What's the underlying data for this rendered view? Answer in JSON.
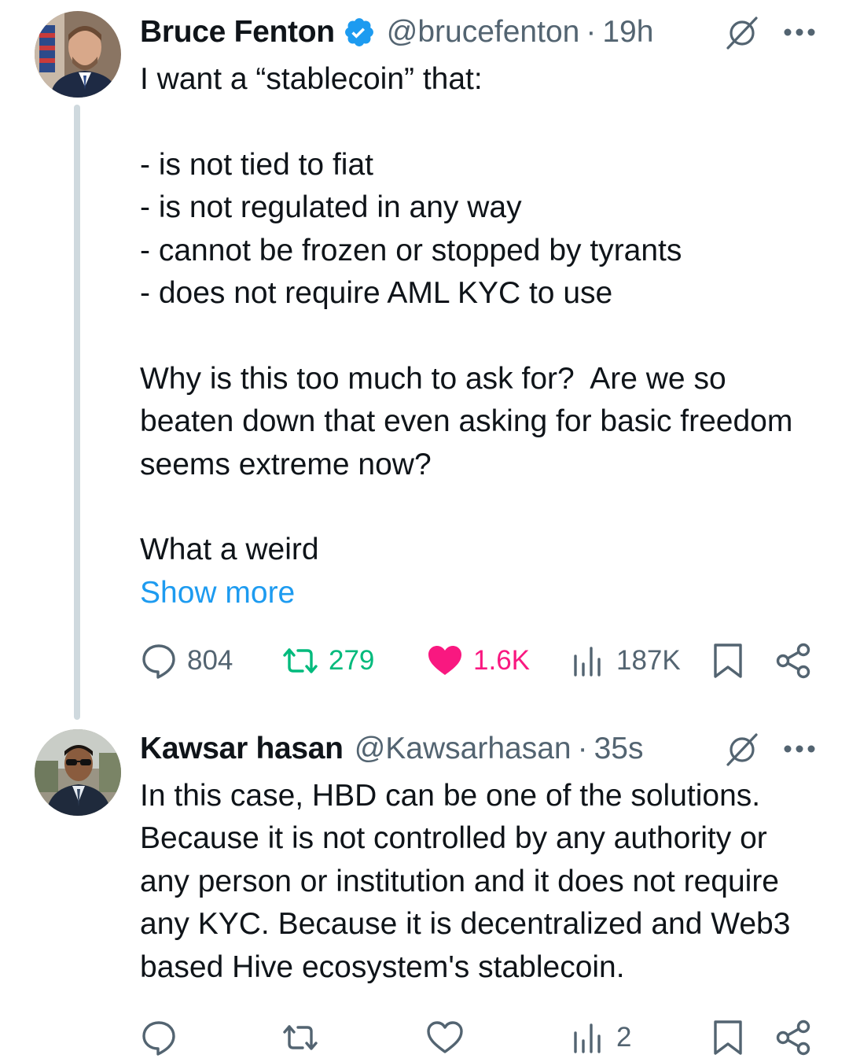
{
  "tweets": [
    {
      "author": {
        "name": "Bruce Fenton",
        "handle": "@brucefenton",
        "verified": true,
        "verified_color": "#1d9bf0"
      },
      "time": "19h",
      "separator": "·",
      "text": "I want a “stablecoin” that:\n\n- is not tied to fiat\n- is not regulated in any way\n- cannot be frozen or stopped by tyrants\n- does not require AML KYC to use\n\nWhy is this too much to ask for?  Are we so beaten down that even asking for basic freedom seems extreme now?\n\nWhat a weird",
      "show_more": "Show more",
      "actions": {
        "replies": "804",
        "reposts": "279",
        "likes": "1.6K",
        "views": "187K",
        "reposted": true,
        "liked": true
      }
    },
    {
      "author": {
        "name": "Kawsar hasan",
        "handle": "@Kawsarhasan",
        "verified": false
      },
      "time": "35s",
      "separator": "·",
      "text": "In this case, HBD can be one of the solutions. Because it is not controlled by any authority or any person or institution and it does not require any KYC. Because it is decentralized and Web3 based Hive ecosystem's stablecoin.",
      "actions": {
        "replies": "",
        "reposts": "",
        "likes": "",
        "views": "2"
      }
    }
  ],
  "colors": {
    "accent": "#1d9bf0",
    "repost": "#00ba7c",
    "like": "#f91880",
    "muted": "#536471",
    "text": "#0f1419"
  },
  "icons": [
    "verified-badge-icon",
    "grok-icon",
    "more-icon",
    "reply-icon",
    "repost-icon",
    "like-icon",
    "views-icon",
    "bookmark-icon",
    "share-icon"
  ]
}
